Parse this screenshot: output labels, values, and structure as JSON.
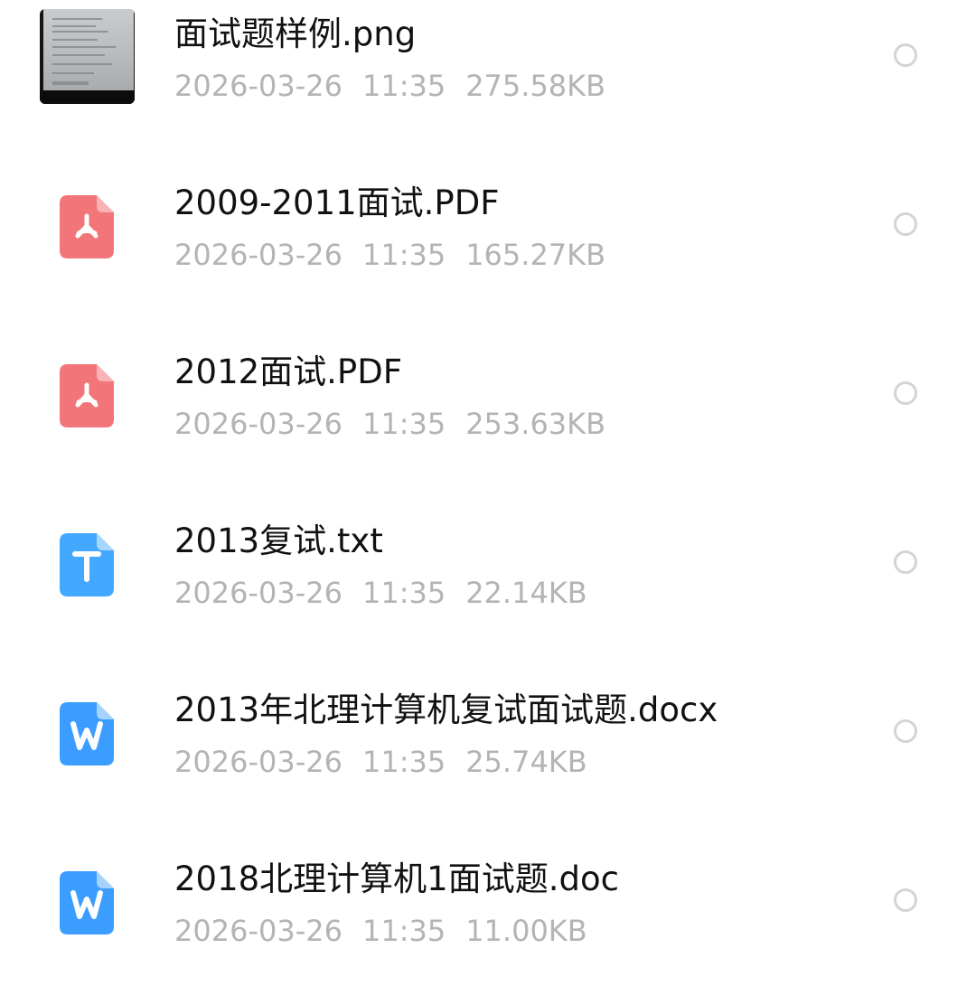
{
  "files": [
    {
      "name": "面试题样例.png",
      "type": "image",
      "icon": "image-thumbnail",
      "date": "2026-03-26",
      "time": "11:35",
      "size": "275.58KB"
    },
    {
      "name": "2009-2011面试.PDF",
      "type": "pdf",
      "icon": "pdf-file-icon",
      "date": "2026-03-26",
      "time": "11:35",
      "size": "165.27KB"
    },
    {
      "name": "2012面试.PDF",
      "type": "pdf",
      "icon": "pdf-file-icon",
      "date": "2026-03-26",
      "time": "11:35",
      "size": "253.63KB"
    },
    {
      "name": "2013复试.txt",
      "type": "txt",
      "icon": "text-file-icon",
      "date": "2026-03-26",
      "time": "11:35",
      "size": "22.14KB"
    },
    {
      "name": "2013年北理计算机复试面试题.docx",
      "type": "word",
      "icon": "word-file-icon",
      "date": "2026-03-26",
      "time": "11:35",
      "size": "25.74KB"
    },
    {
      "name": "2018北理计算机1面试题.doc",
      "type": "word",
      "icon": "word-file-icon",
      "date": "2026-03-26",
      "time": "11:35",
      "size": "11.00KB"
    }
  ],
  "colors": {
    "pdf": "#f2757a",
    "txt": "#43a8ff",
    "word": "#3b9dff",
    "name_text": "#111111",
    "meta_text": "#b4b4b4",
    "radio_border": "#d4d4d4"
  }
}
